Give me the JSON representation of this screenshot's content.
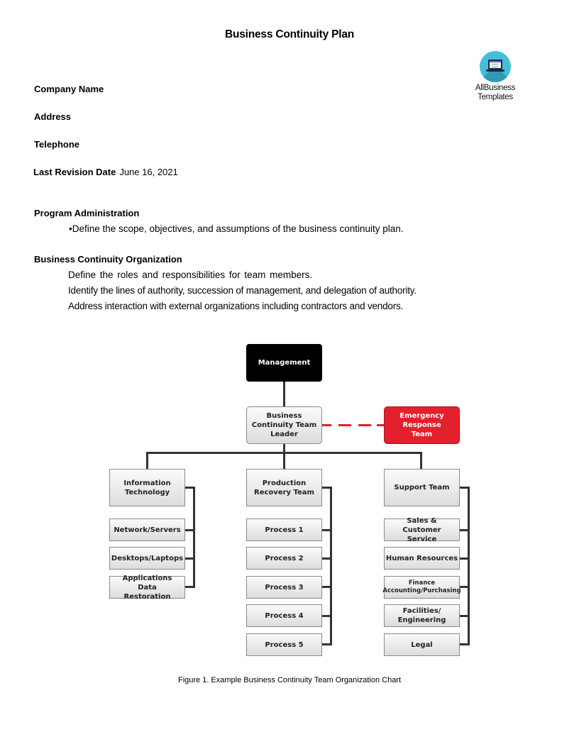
{
  "document": {
    "title": "Business Continuity Plan"
  },
  "logo": {
    "icon": "laptop-icon",
    "line1": "AllBusiness",
    "line2": "Templates"
  },
  "fields": {
    "company_name_label": "Company Name",
    "address_label": "Address",
    "telephone_label": "Telephone",
    "last_revision_label": "Last Revision Date",
    "last_revision_value": "June 16, 2021"
  },
  "sections": {
    "program_admin": {
      "heading": "Program Administration",
      "bullet": "•Define the scope, objectives, and assumptions of the business continuity plan."
    },
    "bc_org": {
      "heading": "Business Continuity Organization",
      "lines": [
        "Define the roles and responsibilities for team members.",
        "Identify the lines of authority, succession of management, and delegation of authority.",
        "Address interaction with external organizations including contractors and vendors."
      ]
    }
  },
  "org_chart": {
    "management": "Management",
    "team_leader": "Business Continuity Team Leader",
    "emergency": "Emergency Response Team",
    "colors": {
      "emergency": "#e4202f",
      "management": "#000000"
    },
    "columns": [
      {
        "head": "Information Technology",
        "items": [
          "Network/Servers",
          "Desktops/Laptops",
          "Applications Data Restoration"
        ]
      },
      {
        "head": "Production Recovery Team",
        "items": [
          "Process 1",
          "Process 2",
          "Process 3",
          "Process 4",
          "Process 5"
        ]
      },
      {
        "head": "Support Team",
        "items": [
          "Sales & Customer Service",
          "Human Resources",
          "Finance Accounting/Purchasing",
          "Facilities/ Engineering",
          "Legal"
        ]
      }
    ],
    "caption": "Figure 1. Example Business Continuity Team Organization Chart"
  }
}
